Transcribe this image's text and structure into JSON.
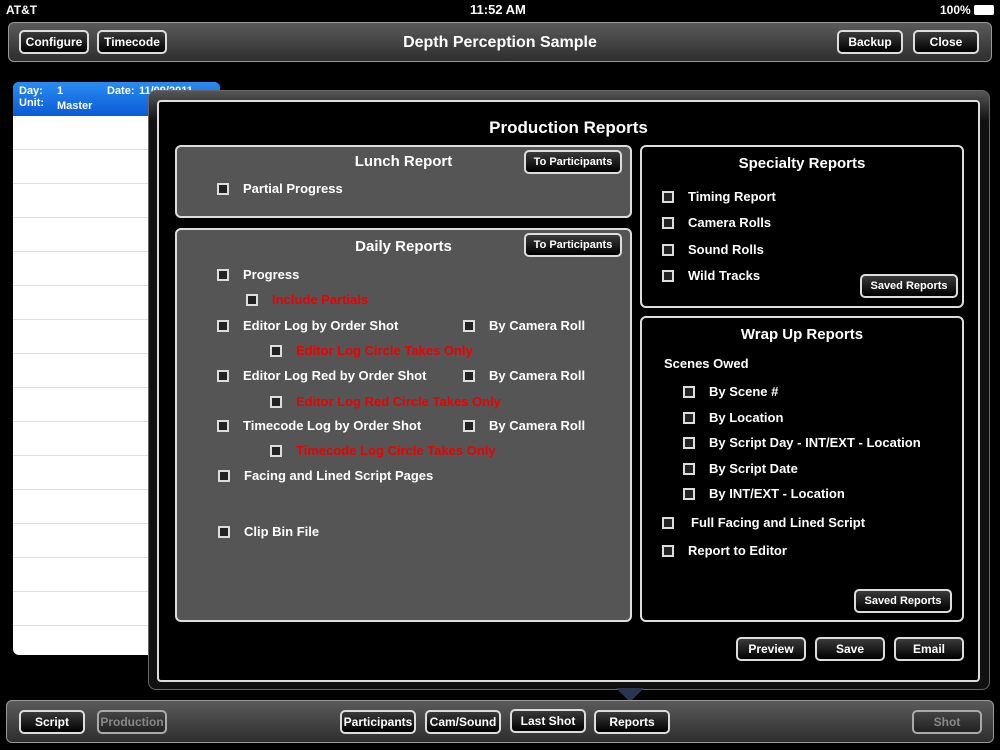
{
  "status": {
    "carrier": "AT&T",
    "time": "11:52 AM",
    "battery": "100%"
  },
  "topbar": {
    "title": "Depth Perception Sample",
    "configure": "Configure",
    "timecode": "Timecode",
    "backup": "Backup",
    "close": "Close"
  },
  "day_list": {
    "day_label": "Day:",
    "day": "1",
    "date_label": "Date:",
    "date": "11/09/2011",
    "unit_label": "Unit:",
    "unit": "Master"
  },
  "popover": {
    "title": "Production Reports",
    "lunch": {
      "title": "Lunch Report",
      "to_participants": "To Participants",
      "items": [
        "Partial Progress"
      ]
    },
    "daily": {
      "title": "Daily Reports",
      "to_participants": "To Participants",
      "progress": "Progress",
      "include_partials": "Include Partials",
      "editor_log": "Editor Log by Order Shot",
      "by_camera_roll": "By Camera Roll",
      "editor_circle": "Editor Log Circle Takes Only",
      "editor_red": "Editor Log Red by Order Shot",
      "editor_red_circle": "Editor Log Red Circle Takes Only",
      "timecode_log": "Timecode Log by Order Shot",
      "timecode_circle": "Timecode Log Circle Takes Only",
      "facing": "Facing and Lined Script Pages",
      "clip_bin": "Clip Bin File"
    },
    "specialty": {
      "title": "Specialty Reports",
      "items": [
        "Timing Report",
        "Camera Rolls",
        "Sound Rolls",
        "Wild Tracks"
      ],
      "saved": "Saved Reports"
    },
    "wrap": {
      "title": "Wrap Up Reports",
      "scenes_owed": "Scenes Owed",
      "scene_items": [
        "By Scene #",
        "By Location",
        "By Script Day - INT/EXT - Location",
        "By Script Date",
        "By INT/EXT - Location"
      ],
      "full_facing": "Full Facing and Lined Script",
      "report_editor": "Report to Editor",
      "saved": "Saved Reports"
    },
    "preview": "Preview",
    "save": "Save",
    "email": "Email"
  },
  "bottombar": {
    "script": "Script",
    "production": "Production",
    "participants": "Participants",
    "cam_sound": "Cam/Sound",
    "last_shot": "Last Shot",
    "reports": "Reports",
    "shot": "Shot"
  }
}
